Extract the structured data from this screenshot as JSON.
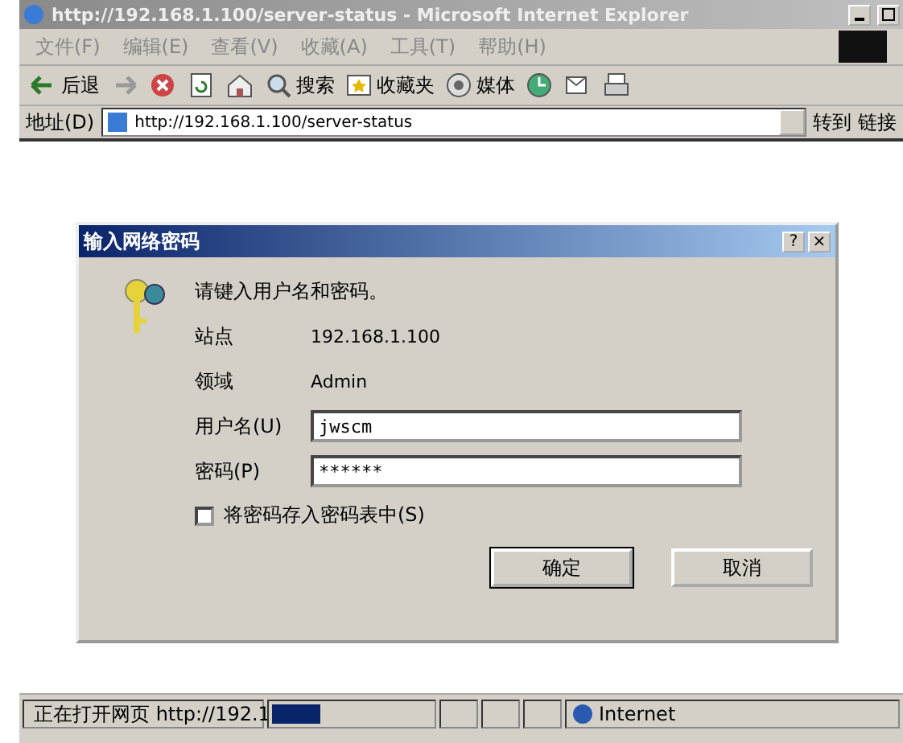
{
  "window": {
    "title": "http://192.168.1.100/server-status - Microsoft Internet Explorer"
  },
  "menu": [
    "文件(F)",
    "编辑(E)",
    "查看(V)",
    "收藏(A)",
    "工具(T)",
    "帮助(H)"
  ],
  "toolbar": [
    {
      "kind": "back",
      "label": "后退"
    },
    {
      "kind": "forward"
    },
    {
      "kind": "stop"
    },
    {
      "kind": "refresh"
    },
    {
      "kind": "home"
    },
    {
      "kind": "search",
      "label": "搜索"
    },
    {
      "kind": "favorites",
      "label": "收藏夹"
    },
    {
      "kind": "media",
      "label": "媒体"
    },
    {
      "kind": "history"
    },
    {
      "kind": "mail"
    },
    {
      "kind": "print"
    }
  ],
  "address_bar": {
    "label": "地址(D)",
    "value": "http://192.168.1.100/server-status",
    "go": "转到",
    "links": "链接"
  },
  "dialog": {
    "title": "输入网络密码",
    "help": "?",
    "close": "×",
    "prompt": "请键入用户名和密码。",
    "info": [
      {
        "label": "站点",
        "value": "192.168.1.100"
      },
      {
        "label": "领域",
        "value": "Admin"
      }
    ],
    "fields": [
      {
        "label": "用户名(U)",
        "value": "jwscm"
      },
      {
        "label": "密码(P)",
        "value": "******"
      }
    ],
    "save_password": {
      "label": "将密码存入密码表中(S)",
      "checked": false
    },
    "buttons": [
      "确定",
      "取消"
    ]
  },
  "status_bar": {
    "text": "正在打开网页 http://192.1",
    "level": 0.3,
    "zone": "Internet"
  }
}
